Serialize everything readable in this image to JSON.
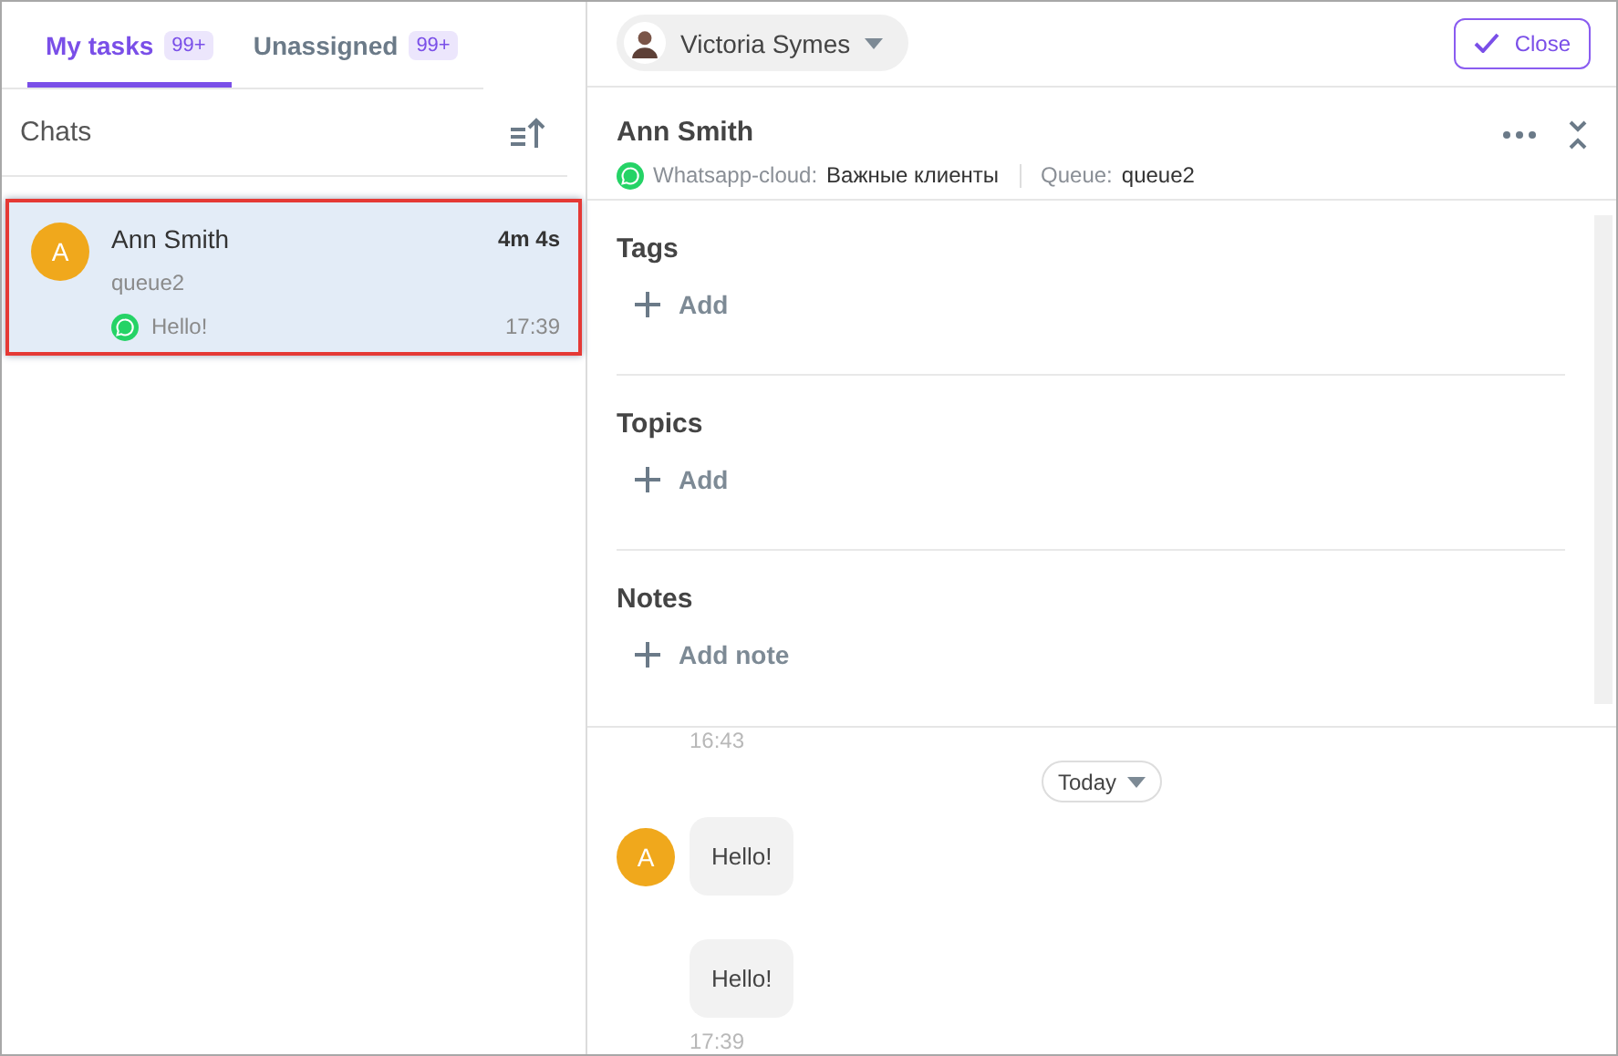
{
  "tabs": [
    {
      "label": "My tasks",
      "badge": "99+",
      "selected": true
    },
    {
      "label": "Unassigned",
      "badge": "99+",
      "selected": false
    }
  ],
  "chats_panel": {
    "title": "Chats",
    "items": [
      {
        "avatar": "A",
        "name": "Ann Smith",
        "duration": "4m 4s",
        "queue": "queue2",
        "last_message": "Hello!",
        "time": "17:39",
        "selected": true
      }
    ]
  },
  "agent": {
    "name": "Victoria Symes"
  },
  "close_button": "Close",
  "contact": {
    "name": "Ann Smith",
    "channel_label": "Whatsapp-cloud:",
    "channel_value": "Важные клиенты",
    "queue_label": "Queue:",
    "queue_value": "queue2"
  },
  "sections": [
    {
      "title": "Tags",
      "action": "Add"
    },
    {
      "title": "Topics",
      "action": "Add"
    },
    {
      "title": "Notes",
      "action": "Add note"
    }
  ],
  "conversation": {
    "earlier_time": "16:43",
    "date_chip": "Today",
    "messages": [
      {
        "text": "Hello!",
        "show_avatar": true,
        "avatar": "A"
      },
      {
        "text": "Hello!",
        "show_avatar": false
      }
    ],
    "last_time": "17:39"
  }
}
